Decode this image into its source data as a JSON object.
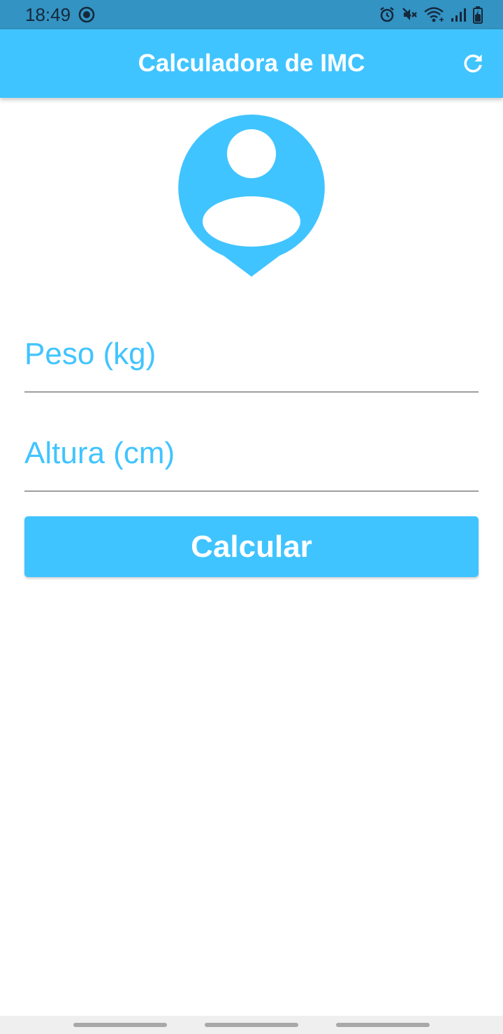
{
  "status_bar": {
    "time": "18:49",
    "icons": [
      "record-icon",
      "alarm-icon",
      "mute-icon",
      "wifi-icon",
      "signal-icon",
      "battery-icon"
    ]
  },
  "app_bar": {
    "title": "Calculadora de IMC",
    "refresh_icon": "refresh-icon"
  },
  "avatar": {
    "icon": "person-pin-icon"
  },
  "form": {
    "weight_placeholder": "Peso (kg)",
    "weight_value": "",
    "height_placeholder": "Altura (cm)",
    "height_value": "",
    "calculate_label": "Calcular"
  },
  "nav_bar": {
    "items": [
      "recent-apps",
      "home",
      "back"
    ]
  },
  "colors": {
    "accent": "#40c4ff",
    "status_bar": "#3393c2",
    "divider": "#9e9e9e"
  }
}
